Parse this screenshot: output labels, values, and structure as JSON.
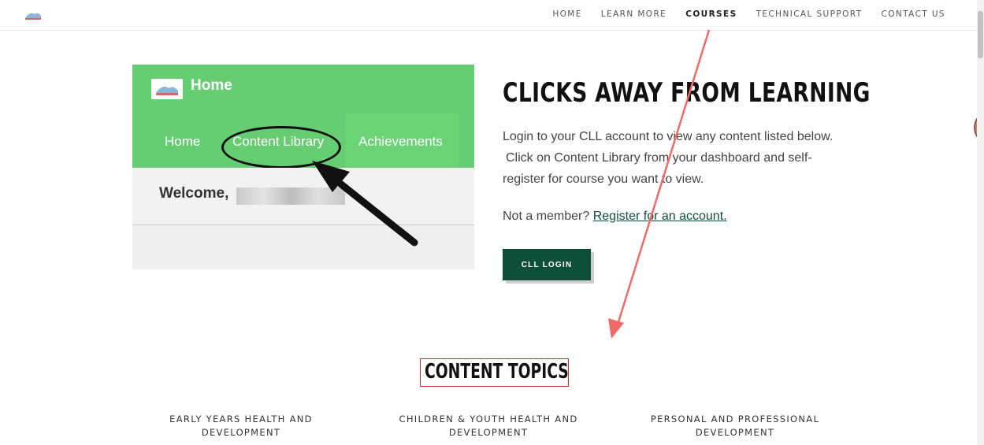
{
  "header": {
    "nav": [
      "HOME",
      "LEARN MORE",
      "COURSES",
      "TECHNICAL SUPPORT",
      "CONTACT US"
    ],
    "active_index": 2
  },
  "preview": {
    "title": "Home",
    "tabs": [
      "Home",
      "Content Library",
      "Achievements"
    ],
    "welcome": "Welcome,"
  },
  "hero": {
    "headline": "CLICKS AWAY FROM LEARNING",
    "desc_line1": "Login to your CLL account to view any content listed below.",
    "desc_line2": "Click on Content Library from your dashboard and self-",
    "desc_line3": "register for course you want to view.",
    "member_prefix": "Not a member?",
    "register_link": "Register for an account.",
    "login_button": "CLL LOGIN"
  },
  "topics": {
    "title": "CONTENT TOPICS",
    "items": [
      {
        "line1": "EARLY YEARS HEALTH AND",
        "line2": "DEVELOPMENT"
      },
      {
        "line1": "CHILDREN & YOUTH HEALTH AND",
        "line2": "DEVELOPMENT"
      },
      {
        "line1": "PERSONAL AND PROFESSIONAL",
        "line2": "DEVELOPMENT"
      }
    ]
  },
  "colors": {
    "preview_green": "#67cd72",
    "button_green": "#0e4f3b",
    "annotation_red": "#f06a6a",
    "box_red": "#d9242e"
  }
}
